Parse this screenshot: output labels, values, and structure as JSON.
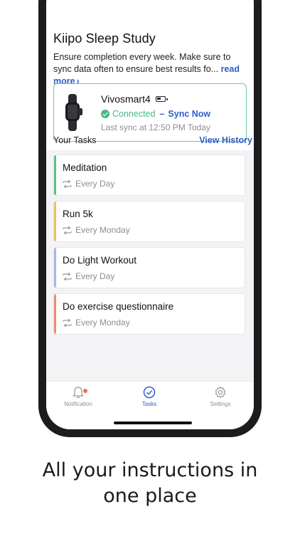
{
  "study": {
    "title": "Kiipo Sleep Study",
    "description": "Ensure completion every week. Make sure to sync data often to ensure best results fo...",
    "read_more": "read more"
  },
  "device": {
    "name": "Vivosmart4",
    "status": "Connected",
    "separator": "–",
    "sync_label": "Sync Now",
    "last_sync": "Last sync at 12:50 PM Today",
    "battery_level": 0.5,
    "status_color": "#4cb885"
  },
  "tasks": {
    "title": "Your Tasks",
    "view_history": "View History",
    "items": [
      {
        "name": "Meditation",
        "frequency": "Every Day",
        "color": "#5dbf84"
      },
      {
        "name": "Run 5k",
        "frequency": "Every Monday",
        "color": "#f0c05a"
      },
      {
        "name": "Do Light Workout",
        "frequency": "Every Day",
        "color": "#a9b4ee"
      },
      {
        "name": "Do exercise questionnaire",
        "frequency": "Every Monday",
        "color": "#ec8e6b"
      }
    ]
  },
  "tabbar": {
    "notification": "Notification",
    "tasks": "Tasks",
    "settings": "Settings",
    "active": "tasks"
  },
  "caption": {
    "line1": "All your instructions in",
    "line2": "one place"
  },
  "colors": {
    "accent": "#2f5fc8",
    "notification_dot": "#e8734f"
  }
}
